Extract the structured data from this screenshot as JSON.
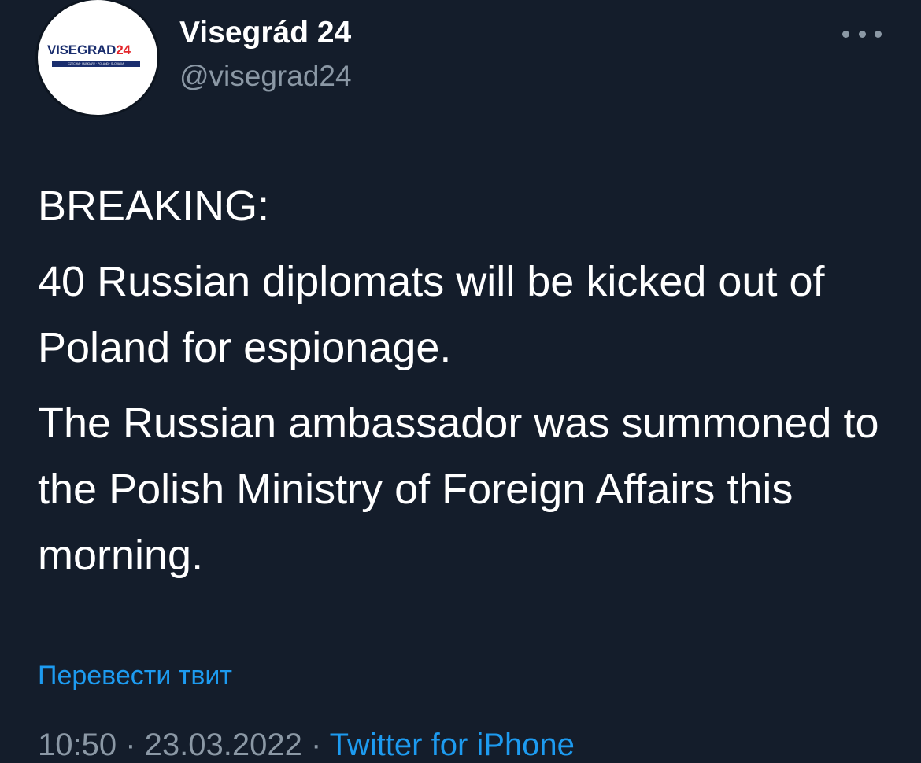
{
  "author": {
    "display_name": "Visegrád 24",
    "handle": "@visegrad24",
    "avatar": {
      "logo_word": "VISEGRAD",
      "logo_number": "24",
      "logo_strip": "CZECHIA · HUNGARY · POLAND · SLOVAKIA",
      "brand_blue": "#1a2e6e",
      "brand_red": "#e3262b"
    }
  },
  "menu": {
    "icon": "more-horizontal-icon"
  },
  "tweet": {
    "paragraphs": [
      "BREAKING:",
      "40 Russian diplomats will be kicked out of Poland for espionage.",
      "The Russian ambassador was summoned to the Polish Ministry of Foreign Affairs this morning."
    ]
  },
  "translate_link": "Перевести твит",
  "meta": {
    "time_date": "10:50 · 23.03.2022 · ",
    "source": "Twitter for iPhone"
  },
  "colors": {
    "background": "#141d2b",
    "text": "#ffffff",
    "secondary_text": "#8b98a5",
    "link": "#1d9bf0"
  }
}
